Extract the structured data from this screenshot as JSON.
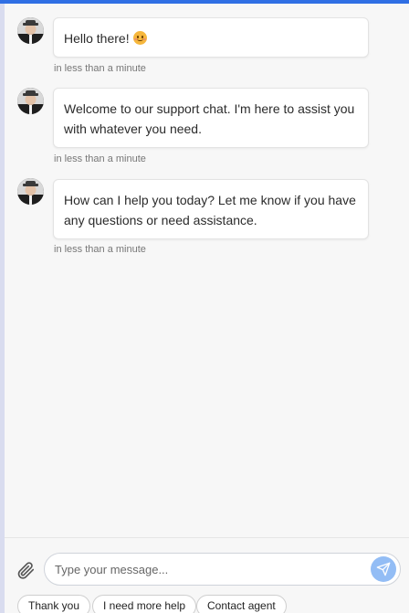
{
  "colors": {
    "accent": "#2f6fe4",
    "background": "#f7f7f7",
    "bubble": "#ffffff",
    "send_button": "#93bdf5"
  },
  "messages": [
    {
      "text": "Hello there!",
      "emoji": "smiling-face-icon",
      "time": "in less than a minute"
    },
    {
      "text": "Welcome to our support chat. I'm here to assist you with whatever you need.",
      "time": "in less than a minute"
    },
    {
      "text": "How can I help you today? Let me know if you have any questions or need assistance.",
      "time": "in less than a minute"
    }
  ],
  "composer": {
    "placeholder": "Type your message...",
    "value": "",
    "attach_icon": "paperclip-icon",
    "send_icon": "send-icon"
  },
  "quick_replies": [
    "Thank you",
    "I need more help",
    "Contact agent"
  ]
}
